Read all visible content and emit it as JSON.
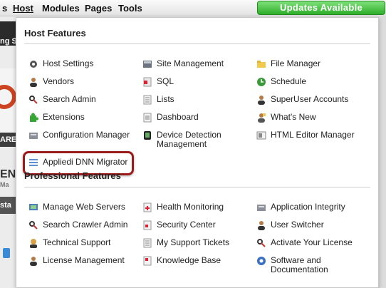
{
  "menu": {
    "items": [
      {
        "label": "s",
        "active": false
      },
      {
        "label": "Host",
        "active": true
      },
      {
        "label": "Modules",
        "active": false
      },
      {
        "label": "Pages",
        "active": false
      },
      {
        "label": "Tools",
        "active": false
      }
    ],
    "updates_label": "Updates Available"
  },
  "background": {
    "fragment_1": "ng S",
    "fragment_2": "ARE",
    "fragment_3": "EN",
    "fragment_4": "Ma",
    "fragment_5": "sta"
  },
  "host_features": {
    "title": "Host Features",
    "col1": [
      {
        "label": "Host Settings",
        "icon": "gear-icon"
      },
      {
        "label": "Vendors",
        "icon": "user-icon"
      },
      {
        "label": "Search Admin",
        "icon": "search-admin-icon"
      },
      {
        "label": "Extensions",
        "icon": "puzzle-icon"
      },
      {
        "label": "Configuration Manager",
        "icon": "config-icon"
      },
      {
        "label": "Appliedi DNN Migrator",
        "icon": "migrator-icon"
      }
    ],
    "col2": [
      {
        "label": "Site Management",
        "icon": "site-icon"
      },
      {
        "label": "SQL",
        "icon": "sql-icon"
      },
      {
        "label": "Lists",
        "icon": "list-icon"
      },
      {
        "label": "Dashboard",
        "icon": "dashboard-icon"
      },
      {
        "label": "Device Detection Management",
        "icon": "device-icon"
      }
    ],
    "col3": [
      {
        "label": "File Manager",
        "icon": "folder-icon"
      },
      {
        "label": "Schedule",
        "icon": "schedule-icon"
      },
      {
        "label": "SuperUser Accounts",
        "icon": "superuser-icon"
      },
      {
        "label": "What's New",
        "icon": "whats-new-icon"
      },
      {
        "label": "HTML Editor Manager",
        "icon": "html-editor-icon"
      }
    ]
  },
  "professional_features": {
    "title": "Professional Features",
    "col1": [
      {
        "label": "Manage Web Servers",
        "icon": "web-servers-icon"
      },
      {
        "label": "Search Crawler Admin",
        "icon": "crawler-icon"
      },
      {
        "label": "Technical Support",
        "icon": "support-icon"
      },
      {
        "label": "License Management",
        "icon": "license-icon"
      }
    ],
    "col2": [
      {
        "label": "Health Monitoring",
        "icon": "health-icon"
      },
      {
        "label": "Security Center",
        "icon": "security-icon"
      },
      {
        "label": "My Support Tickets",
        "icon": "tickets-icon"
      },
      {
        "label": "Knowledge Base",
        "icon": "knowledge-icon"
      }
    ],
    "col3": [
      {
        "label": "Application Integrity",
        "icon": "integrity-icon"
      },
      {
        "label": "User Switcher",
        "icon": "user-switcher-icon"
      },
      {
        "label": "Activate Your License",
        "icon": "activate-icon"
      },
      {
        "label": "Software and Documentation",
        "icon": "software-icon"
      }
    ]
  },
  "colors": {
    "highlight": "#9b1b1b",
    "updates_green": "#2fae2a"
  }
}
